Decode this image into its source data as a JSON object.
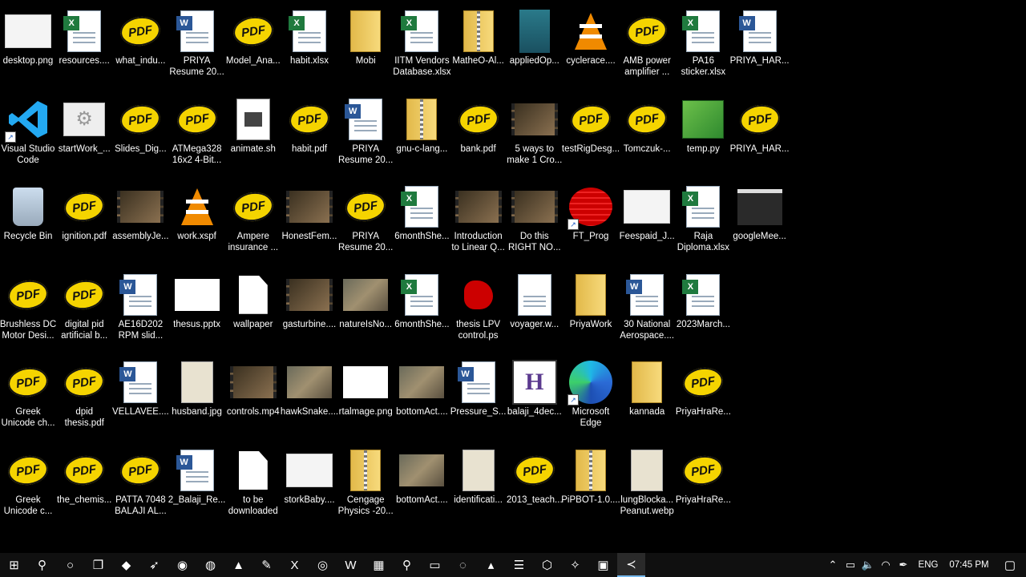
{
  "desktop": {
    "icons": [
      {
        "row": 0,
        "col": 0,
        "type": "image-light",
        "lines": [
          "desktop.png"
        ]
      },
      {
        "row": 0,
        "col": 1,
        "type": "excel",
        "lines": [
          "resources...."
        ]
      },
      {
        "row": 0,
        "col": 2,
        "type": "pdf",
        "lines": [
          "what_indu..."
        ]
      },
      {
        "row": 0,
        "col": 3,
        "type": "word",
        "lines": [
          "PRIYA",
          "Resume 20..."
        ]
      },
      {
        "row": 0,
        "col": 4,
        "type": "pdf",
        "lines": [
          "Model_Ana..."
        ]
      },
      {
        "row": 0,
        "col": 5,
        "type": "excel",
        "lines": [
          "habit.xlsx"
        ]
      },
      {
        "row": 0,
        "col": 6,
        "type": "folder",
        "lines": [
          "Mobi"
        ]
      },
      {
        "row": 0,
        "col": 7,
        "type": "excel",
        "lines": [
          "IITM Vendors",
          "Database.xlsx"
        ]
      },
      {
        "row": 0,
        "col": 8,
        "type": "zip",
        "lines": [
          "MatheO-Al..."
        ]
      },
      {
        "row": 0,
        "col": 9,
        "type": "image-teal",
        "lines": [
          "appliedOp..."
        ]
      },
      {
        "row": 0,
        "col": 10,
        "type": "vlc",
        "lines": [
          "cyclerace...."
        ]
      },
      {
        "row": 0,
        "col": 11,
        "type": "pdf",
        "lines": [
          "AMB power",
          "amplifier ..."
        ]
      },
      {
        "row": 0,
        "col": 12,
        "type": "excel",
        "lines": [
          "PA16",
          "sticker.xlsx"
        ]
      },
      {
        "row": 0,
        "col": 13,
        "type": "word",
        "lines": [
          "PRIYA_HAR..."
        ]
      },
      {
        "row": 1,
        "col": 0,
        "type": "vscode",
        "shortcut": true,
        "lines": [
          "Visual Studio",
          "Code"
        ]
      },
      {
        "row": 1,
        "col": 1,
        "type": "gear",
        "lines": [
          "startWork_..."
        ]
      },
      {
        "row": 1,
        "col": 2,
        "type": "pdf",
        "lines": [
          "Slides_Dig..."
        ]
      },
      {
        "row": 1,
        "col": 3,
        "type": "pdf",
        "lines": [
          "ATMega328",
          "16x2 4-Bit..."
        ]
      },
      {
        "row": 1,
        "col": 4,
        "type": "script",
        "lines": [
          "animate.sh"
        ]
      },
      {
        "row": 1,
        "col": 5,
        "type": "pdf",
        "lines": [
          "habit.pdf"
        ]
      },
      {
        "row": 1,
        "col": 6,
        "type": "word",
        "lines": [
          "PRIYA",
          "Resume 20..."
        ]
      },
      {
        "row": 1,
        "col": 7,
        "type": "zip",
        "lines": [
          "gnu-c-lang..."
        ]
      },
      {
        "row": 1,
        "col": 8,
        "type": "pdf",
        "lines": [
          "bank.pdf"
        ]
      },
      {
        "row": 1,
        "col": 9,
        "type": "video",
        "lines": [
          "5 ways to",
          "make 1 Cro..."
        ]
      },
      {
        "row": 1,
        "col": 10,
        "type": "pdf",
        "lines": [
          "testRigDesg..."
        ]
      },
      {
        "row": 1,
        "col": 11,
        "type": "pdf",
        "lines": [
          "Tomczuk-..."
        ]
      },
      {
        "row": 1,
        "col": 12,
        "type": "python",
        "lines": [
          "temp.py"
        ]
      },
      {
        "row": 1,
        "col": 13,
        "type": "pdf",
        "lines": [
          "PRIYA_HAR..."
        ]
      },
      {
        "row": 2,
        "col": 0,
        "type": "recycle",
        "lines": [
          "Recycle Bin"
        ]
      },
      {
        "row": 2,
        "col": 1,
        "type": "pdf",
        "lines": [
          "ignition.pdf"
        ]
      },
      {
        "row": 2,
        "col": 2,
        "type": "video",
        "lines": [
          "assemblyJe..."
        ]
      },
      {
        "row": 2,
        "col": 3,
        "type": "vlc",
        "lines": [
          "work.xspf"
        ]
      },
      {
        "row": 2,
        "col": 4,
        "type": "pdf",
        "lines": [
          "Ampere",
          "insurance ..."
        ]
      },
      {
        "row": 2,
        "col": 5,
        "type": "video",
        "lines": [
          "HonestFem..."
        ]
      },
      {
        "row": 2,
        "col": 6,
        "type": "pdf",
        "lines": [
          "PRIYA",
          "Resume 20..."
        ]
      },
      {
        "row": 2,
        "col": 7,
        "type": "excel",
        "lines": [
          "6monthShe..."
        ]
      },
      {
        "row": 2,
        "col": 8,
        "type": "video",
        "lines": [
          "Introduction",
          "to Linear Q..."
        ]
      },
      {
        "row": 2,
        "col": 9,
        "type": "video",
        "lines": [
          "Do this",
          "RIGHT NO..."
        ]
      },
      {
        "row": 2,
        "col": 10,
        "type": "prog",
        "shortcut": true,
        "lines": [
          "FT_Prog"
        ]
      },
      {
        "row": 2,
        "col": 11,
        "type": "image-light",
        "lines": [
          "Feespaid_J..."
        ]
      },
      {
        "row": 2,
        "col": 12,
        "type": "excel",
        "lines": [
          "Raja",
          "Diploma.xlsx"
        ]
      },
      {
        "row": 2,
        "col": 13,
        "type": "image-dark",
        "lines": [
          "googleMee..."
        ]
      },
      {
        "row": 3,
        "col": 0,
        "type": "pdf",
        "lines": [
          "Brushless DC",
          "Motor Desi..."
        ]
      },
      {
        "row": 3,
        "col": 1,
        "type": "pdf",
        "lines": [
          "digital pid",
          "artificial b..."
        ]
      },
      {
        "row": 3,
        "col": 2,
        "type": "word",
        "lines": [
          "AE16D202",
          "RPM slid..."
        ]
      },
      {
        "row": 3,
        "col": 3,
        "type": "image-white",
        "lines": [
          "thesus.pptx"
        ]
      },
      {
        "row": 3,
        "col": 4,
        "type": "file",
        "lines": [
          "wallpaper"
        ]
      },
      {
        "row": 3,
        "col": 5,
        "type": "video",
        "lines": [
          "gasturbine...."
        ]
      },
      {
        "row": 3,
        "col": 6,
        "type": "image-photo",
        "lines": [
          "natureIsNo..."
        ]
      },
      {
        "row": 3,
        "col": 7,
        "type": "excel",
        "lines": [
          "6monthShe..."
        ]
      },
      {
        "row": 3,
        "col": 8,
        "type": "ps",
        "lines": [
          "thesis LPV",
          "control.ps"
        ]
      },
      {
        "row": 3,
        "col": 9,
        "type": "doc-plain",
        "lines": [
          "voyager.w..."
        ]
      },
      {
        "row": 3,
        "col": 10,
        "type": "folder",
        "lines": [
          "PriyaWork"
        ]
      },
      {
        "row": 3,
        "col": 11,
        "type": "word",
        "lines": [
          "30 National",
          "Aerospace...."
        ]
      },
      {
        "row": 3,
        "col": 12,
        "type": "excel",
        "lines": [
          "2023March..."
        ]
      },
      {
        "row": 4,
        "col": 0,
        "type": "pdf",
        "lines": [
          "Greek",
          "Unicode ch..."
        ]
      },
      {
        "row": 4,
        "col": 1,
        "type": "pdf",
        "lines": [
          "dpid",
          "thesis.pdf"
        ]
      },
      {
        "row": 4,
        "col": 2,
        "type": "word",
        "lines": [
          "VELLAVEE...."
        ]
      },
      {
        "row": 4,
        "col": 3,
        "type": "image-paper",
        "lines": [
          "husband.jpg"
        ]
      },
      {
        "row": 4,
        "col": 4,
        "type": "video",
        "lines": [
          "controls.mp4"
        ]
      },
      {
        "row": 4,
        "col": 5,
        "type": "image-photo",
        "lines": [
          "hawkSnake...."
        ]
      },
      {
        "row": 4,
        "col": 6,
        "type": "image-white",
        "lines": [
          "rtalmage.png"
        ]
      },
      {
        "row": 4,
        "col": 7,
        "type": "image-photo",
        "lines": [
          "bottomAct...."
        ]
      },
      {
        "row": 4,
        "col": 8,
        "type": "word",
        "lines": [
          "Pressure_S..."
        ]
      },
      {
        "row": 4,
        "col": 9,
        "type": "fav",
        "lines": [
          "balaji_4dec..."
        ]
      },
      {
        "row": 4,
        "col": 10,
        "type": "edge",
        "shortcut": true,
        "lines": [
          "Microsoft",
          "Edge"
        ]
      },
      {
        "row": 4,
        "col": 11,
        "type": "folder",
        "lines": [
          "kannada"
        ]
      },
      {
        "row": 4,
        "col": 12,
        "type": "pdf",
        "lines": [
          "PriyaHraRe..."
        ]
      },
      {
        "row": 5,
        "col": 0,
        "type": "pdf",
        "lines": [
          "Greek",
          "Unicode c..."
        ]
      },
      {
        "row": 5,
        "col": 1,
        "type": "pdf",
        "lines": [
          "the_chemis..."
        ]
      },
      {
        "row": 5,
        "col": 2,
        "type": "pdf",
        "lines": [
          "PATTA 7048",
          "BALAJI AL..."
        ]
      },
      {
        "row": 5,
        "col": 3,
        "type": "word",
        "lines": [
          "2_Balaji_Re..."
        ]
      },
      {
        "row": 5,
        "col": 4,
        "type": "file",
        "lines": [
          "to be",
          "downloaded"
        ]
      },
      {
        "row": 5,
        "col": 5,
        "type": "image-light",
        "lines": [
          "storkBaby...."
        ]
      },
      {
        "row": 5,
        "col": 6,
        "type": "zip",
        "lines": [
          "Cengage",
          "Physics -20..."
        ]
      },
      {
        "row": 5,
        "col": 7,
        "type": "image-photo",
        "lines": [
          "bottomAct...."
        ]
      },
      {
        "row": 5,
        "col": 8,
        "type": "image-paper",
        "lines": [
          "identificati..."
        ]
      },
      {
        "row": 5,
        "col": 9,
        "type": "pdf",
        "lines": [
          "2013_teach..."
        ]
      },
      {
        "row": 5,
        "col": 10,
        "type": "zip",
        "lines": [
          "PiPBOT-1.0...."
        ]
      },
      {
        "row": 5,
        "col": 11,
        "type": "image-paper",
        "lines": [
          "lungBlocka...",
          "Peanut.webp"
        ]
      },
      {
        "row": 5,
        "col": 12,
        "type": "pdf",
        "lines": [
          "PriyaHraRe..."
        ]
      }
    ]
  },
  "taskbar": {
    "apps": [
      {
        "name": "start-button",
        "glyph": "⊞"
      },
      {
        "name": "search-icon",
        "glyph": "⚲"
      },
      {
        "name": "cortana-icon",
        "glyph": "○"
      },
      {
        "name": "task-view-icon",
        "glyph": "❐"
      },
      {
        "name": "app-icon-1",
        "glyph": "◆"
      },
      {
        "name": "app-icon-2",
        "glyph": "➶"
      },
      {
        "name": "edge-icon",
        "glyph": "◉"
      },
      {
        "name": "firefox-icon",
        "glyph": "◍"
      },
      {
        "name": "vlc-icon",
        "glyph": "▲"
      },
      {
        "name": "notepad-icon",
        "glyph": "✎"
      },
      {
        "name": "excel-icon",
        "glyph": "X"
      },
      {
        "name": "app-icon-3",
        "glyph": "◎"
      },
      {
        "name": "word-icon",
        "glyph": "W"
      },
      {
        "name": "calendar-icon",
        "glyph": "▦"
      },
      {
        "name": "search-app-icon",
        "glyph": "⚲"
      },
      {
        "name": "monitor-icon",
        "glyph": "▭"
      },
      {
        "name": "chrome-icon",
        "glyph": "◌"
      },
      {
        "name": "up-arrow-icon",
        "glyph": "▴"
      },
      {
        "name": "notes-icon",
        "glyph": "☰"
      },
      {
        "name": "cube-icon",
        "glyph": "⬡"
      },
      {
        "name": "tool-icon",
        "glyph": "✧"
      },
      {
        "name": "window-icon",
        "glyph": "▣"
      },
      {
        "name": "vscode-icon",
        "glyph": "≺",
        "active": true
      }
    ],
    "tray": {
      "chevron": "⌃",
      "battery": "▭",
      "volume": "🔈",
      "wifi": "◠",
      "pen": "✒",
      "language": "ENG",
      "time": "07:45 PM",
      "notification": "▢"
    }
  }
}
